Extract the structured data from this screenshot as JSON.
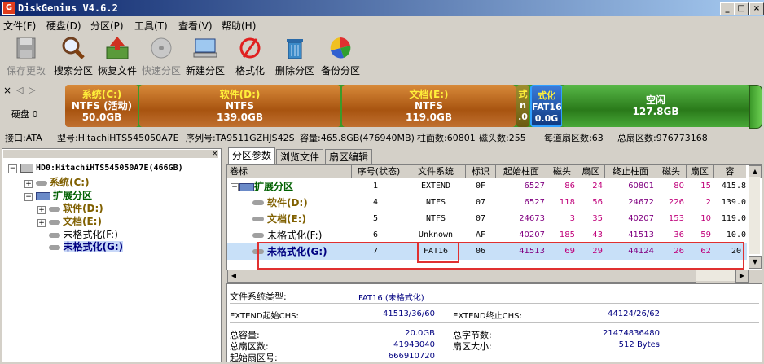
{
  "window": {
    "title": "DiskGenius V4.6.2",
    "app_icon": "G"
  },
  "window_buttons": {
    "minimize": "_",
    "maximize": "□",
    "close": "×"
  },
  "menu": [
    "文件(F)",
    "硬盘(D)",
    "分区(P)",
    "工具(T)",
    "查看(V)",
    "帮助(H)"
  ],
  "toolbar": [
    {
      "label": "保存更改",
      "icon": "save-icon",
      "enabled": false
    },
    {
      "label": "搜索分区",
      "icon": "magnifier-icon",
      "enabled": true
    },
    {
      "label": "恢复文件",
      "icon": "recover-files-icon",
      "enabled": true
    },
    {
      "label": "快速分区",
      "icon": "quick-partition-icon",
      "enabled": false
    },
    {
      "label": "新建分区",
      "icon": "new-partition-icon",
      "enabled": true
    },
    {
      "label": "格式化",
      "icon": "format-icon",
      "enabled": true
    },
    {
      "label": "删除分区",
      "icon": "delete-partition-icon",
      "enabled": true
    },
    {
      "label": "备份分区",
      "icon": "backup-partition-icon",
      "enabled": true
    }
  ],
  "disk_map": {
    "disk_label": "硬盘 0",
    "partitions": [
      {
        "name": "系统(C:)",
        "fs": "NTFS (活动)",
        "size": "50.0GB",
        "color": "#b8621a"
      },
      {
        "name": "软件(D:)",
        "fs": "NTFS",
        "size": "139.0GB",
        "color": "#b8621a"
      },
      {
        "name": "文档(E:)",
        "fs": "NTFS",
        "size": "119.0GB",
        "color": "#b8621a"
      },
      {
        "name": "式",
        "fs": "n",
        "size": ".0",
        "color": "#7a6a1a"
      },
      {
        "name": "式化",
        "fs": "FAT16",
        "size": "0.0G",
        "color": "#1a6ab8"
      },
      {
        "name": "空闲",
        "fs": "",
        "size": "127.8GB",
        "color": "#3c9a2a"
      }
    ]
  },
  "disk_info": {
    "interface": "接口:ATA",
    "model": "型号:HitachiHTS545050A7E",
    "serial": "序列号:TA9511GZHJS42S",
    "capacity": "容量:465.8GB(476940MB)",
    "cylinders": "柱面数:60801",
    "heads": "磁头数:255",
    "sectors_per_track": "每道扇区数:63",
    "total_sectors": "总扇区数:976773168"
  },
  "tree": {
    "disk": "HD0:HitachiHTS545050A7E(466GB)",
    "items": [
      {
        "label": "系统(C:)",
        "color": "#806000",
        "bold": true
      },
      {
        "label": "扩展分区",
        "color": "#006000",
        "bold": true
      },
      {
        "label": "软件(D:)",
        "color": "#806000",
        "bold": true
      },
      {
        "label": "文档(E:)",
        "color": "#806000",
        "bold": true
      },
      {
        "label": "未格式化(F:)",
        "color": "#000000",
        "bold": false
      },
      {
        "label": "未格式化(G:)",
        "color": "#000080",
        "bold": true
      }
    ]
  },
  "tabs": [
    "分区参数",
    "浏览文件",
    "扇区编辑"
  ],
  "table": {
    "headers": [
      "卷标",
      "序号(状态)",
      "文件系统",
      "标识",
      "起始柱面",
      "磁头",
      "扇区",
      "终止柱面",
      "磁头",
      "扇区",
      "容"
    ],
    "rows": [
      {
        "label": "扩展分区",
        "no": "1",
        "fs": "EXTEND",
        "id": "0F",
        "sc": "6527",
        "sh": "86",
        "ss": "24",
        "ec": "60801",
        "eh": "80",
        "es": "15",
        "cap": "415.8"
      },
      {
        "label": "软件(D:)",
        "no": "4",
        "fs": "NTFS",
        "id": "07",
        "sc": "6527",
        "sh": "118",
        "ss": "56",
        "ec": "24672",
        "eh": "226",
        "es": "2",
        "cap": "139.0"
      },
      {
        "label": "文档(E:)",
        "no": "5",
        "fs": "NTFS",
        "id": "07",
        "sc": "24673",
        "sh": "3",
        "ss": "35",
        "ec": "40207",
        "eh": "153",
        "es": "10",
        "cap": "119.0"
      },
      {
        "label": "未格式化(F:)",
        "no": "6",
        "fs": "Unknown",
        "id": "AF",
        "sc": "40207",
        "sh": "185",
        "ss": "43",
        "ec": "41513",
        "eh": "36",
        "es": "59",
        "cap": "10.0"
      },
      {
        "label": "未格式化(G:)",
        "no": "7",
        "fs": "FAT16",
        "id": "06",
        "sc": "41513",
        "sh": "69",
        "ss": "29",
        "ec": "44124",
        "eh": "26",
        "es": "62",
        "cap": "20."
      }
    ]
  },
  "details": {
    "fs_type_label": "文件系统类型:",
    "fs_type_value": "FAT16 (未格式化)",
    "extend_start_label": "EXTEND起始CHS:",
    "extend_start_value": "41513/36/60",
    "extend_end_label": "EXTEND终止CHS:",
    "extend_end_value": "44124/26/62",
    "total_cap_label": "总容量:",
    "total_cap_value": "20.0GB",
    "total_bytes_label": "总字节数:",
    "total_bytes_value": "21474836480",
    "total_sectors_label": "总扇区数:",
    "total_sectors_value": "41943040",
    "sector_size_label": "扇区大小:",
    "sector_size_value": "512 Bytes",
    "start_sector_label": "起始扇区号:",
    "start_sector_value": "666910720"
  }
}
